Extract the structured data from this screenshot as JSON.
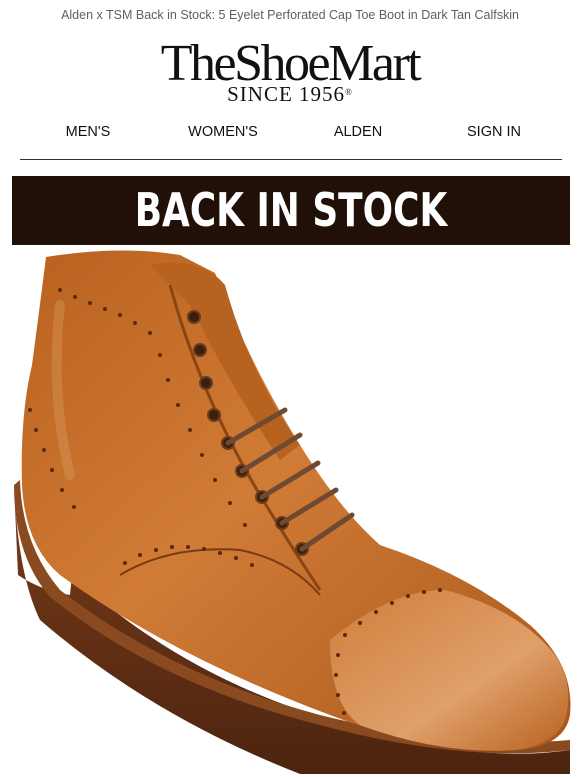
{
  "preheader": "Alden x TSM Back in Stock: 5 Eyelet Perforated Cap Toe Boot in Dark Tan Calfskin",
  "logo": {
    "wordmark": "TheShoeMart",
    "since": "SINCE 1956",
    "registered": "®"
  },
  "nav": {
    "mens": "MEN'S",
    "womens": "WOMEN'S",
    "alden": "ALDEN",
    "signin": "SIGN IN"
  },
  "banner": {
    "text": "BACK IN STOCK"
  },
  "colors": {
    "banner_bg": "#201008",
    "leather": "#c6702c",
    "text": "#111111"
  }
}
